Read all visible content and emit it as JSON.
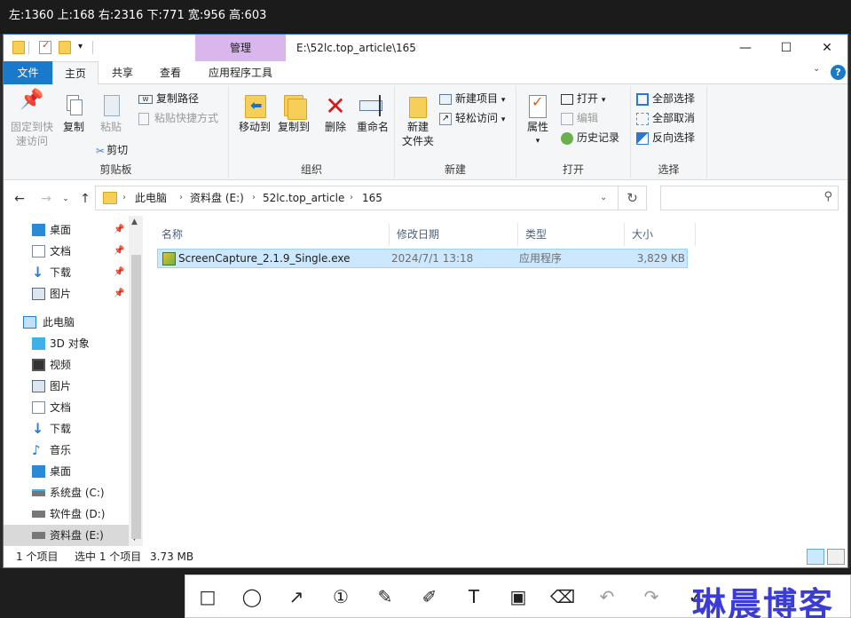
{
  "capture_info": "左:1360 上:168 右:2316 下:771 宽:956 高:603",
  "window": {
    "title_path": "E:\\52lc.top_article\\165",
    "context_tab": "管理",
    "minimize": "—",
    "maximize": "☐",
    "close": "✕"
  },
  "tabs": {
    "file": "文件",
    "home": "主页",
    "share": "共享",
    "view": "查看",
    "app_tools": "应用程序工具"
  },
  "ribbon": {
    "clipboard": {
      "pin": "固定到快\n速访问",
      "copy": "复制",
      "paste": "粘贴",
      "copy_path": "复制路径",
      "paste_shortcut": "粘贴快捷方式",
      "cut": "剪切",
      "label": "剪贴板"
    },
    "organize": {
      "move_to": "移动到",
      "copy_to": "复制到",
      "delete": "删除",
      "rename": "重命名",
      "label": "组织"
    },
    "new": {
      "new_folder": "新建\n文件夹",
      "new_item": "新建项目",
      "easy_access": "轻松访问",
      "label": "新建"
    },
    "open": {
      "properties": "属性",
      "open": "打开",
      "edit": "编辑",
      "history": "历史记录",
      "label": "打开"
    },
    "select": {
      "select_all": "全部选择",
      "select_none": "全部取消",
      "invert": "反向选择",
      "label": "选择"
    }
  },
  "breadcrumb": [
    "此电脑",
    "资料盘 (E:)",
    "52lc.top_article",
    "165"
  ],
  "sidebar": {
    "quick": [
      {
        "label": "桌面",
        "icon": "desktop-icon"
      },
      {
        "label": "文档",
        "icon": "documents-icon"
      },
      {
        "label": "下载",
        "icon": "download-icon"
      },
      {
        "label": "图片",
        "icon": "pictures-icon"
      }
    ],
    "this_pc": "此电脑",
    "pc_items": [
      {
        "label": "3D 对象",
        "icon": "3d-objects-icon"
      },
      {
        "label": "视频",
        "icon": "videos-icon"
      },
      {
        "label": "图片",
        "icon": "pictures-icon"
      },
      {
        "label": "文档",
        "icon": "documents-icon"
      },
      {
        "label": "下载",
        "icon": "download-icon"
      },
      {
        "label": "音乐",
        "icon": "music-icon"
      },
      {
        "label": "桌面",
        "icon": "desktop-icon"
      },
      {
        "label": "系统盘 (C:)",
        "icon": "drive-icon"
      },
      {
        "label": "软件盘 (D:)",
        "icon": "drive-icon"
      },
      {
        "label": "资料盘 (E:)",
        "icon": "drive-icon"
      }
    ]
  },
  "columns": {
    "name": "名称",
    "modified": "修改日期",
    "type": "类型",
    "size": "大小"
  },
  "files": [
    {
      "name": "ScreenCapture_2.1.9_Single.exe",
      "modified": "2024/7/1 13:18",
      "type": "应用程序",
      "size": "3,829 KB"
    }
  ],
  "status": {
    "count": "1 个项目",
    "selected": "选中 1 个项目",
    "size": "3.73 MB"
  },
  "watermark": "琳晨博客",
  "colors": {
    "accent": "#1979ca",
    "context_tab": "#d9b6ec",
    "selection": "#cce8ff"
  }
}
